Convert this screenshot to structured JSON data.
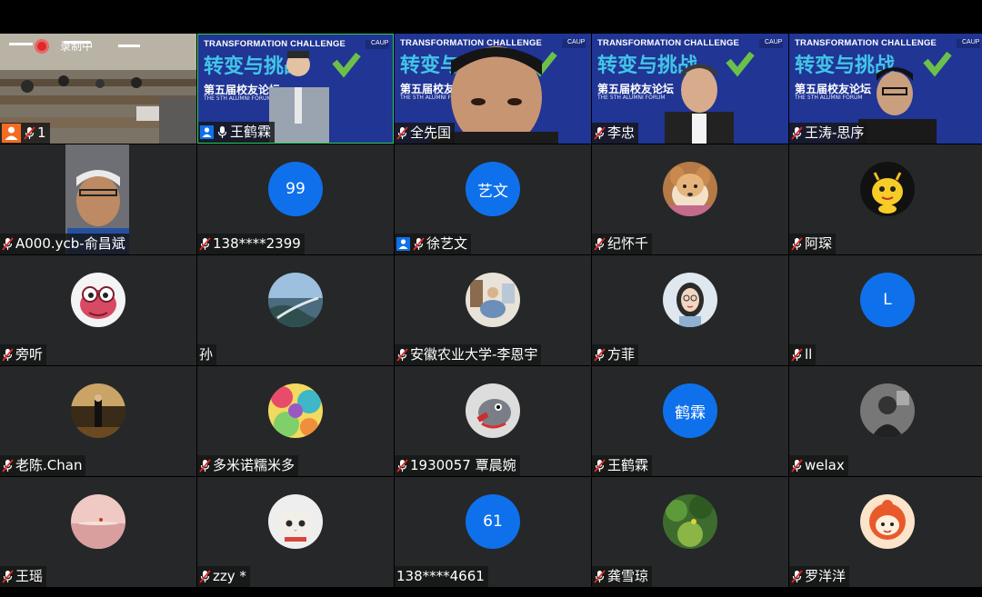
{
  "recording_label": "录制中",
  "banner": {
    "title_en": "TRANSFORMATION CHALLENGE",
    "logo_text": "CAUP",
    "title_cn": "转变与挑战",
    "subtitle_cn": "第五届校友论坛",
    "subtitle_en": "THE 5TH ALUMNI FORUM"
  },
  "participants": [
    {
      "name": "1",
      "type": "classroom",
      "host_icon": true
    },
    {
      "name": "王鹤霖",
      "type": "banner-speaker",
      "icon": "person"
    },
    {
      "name": "全先国",
      "type": "banner-face"
    },
    {
      "name": "李忠",
      "type": "banner-man1"
    },
    {
      "name": "王涛-思序",
      "type": "banner-man2"
    },
    {
      "name": "A000.ycb-俞昌斌",
      "type": "selfie"
    },
    {
      "name": "138****2399",
      "avatar_text": "99"
    },
    {
      "name": "徐艺文",
      "avatar_text": "艺文",
      "icon": "person"
    },
    {
      "name": "纪怀千",
      "avatar": "dog"
    },
    {
      "name": "阿琛",
      "avatar": "dragon"
    },
    {
      "name": "旁听",
      "avatar": "creature"
    },
    {
      "name": "孙",
      "avatar": "landscape",
      "no_mic": true
    },
    {
      "name": "安徽农业大学-李恩宇",
      "avatar": "room"
    },
    {
      "name": "方菲",
      "avatar": "girl"
    },
    {
      "name": "ll",
      "avatar_text": "L"
    },
    {
      "name": "老陈.Chan",
      "avatar": "stage"
    },
    {
      "name": "多米诺糯米多",
      "avatar": "colorful"
    },
    {
      "name": "1930057 覃晨婉",
      "avatar": "fish"
    },
    {
      "name": "王鹤霖",
      "avatar_text": "鹤霖"
    },
    {
      "name": "welax",
      "avatar": "bw"
    },
    {
      "name": "王瑶",
      "avatar": "pink"
    },
    {
      "name": "zzy *",
      "avatar": "cat"
    },
    {
      "name": "138****4661",
      "avatar_text": "61",
      "no_mic": true
    },
    {
      "name": "龚雪琼",
      "avatar": "forest"
    },
    {
      "name": "罗洋洋",
      "avatar": "cartoon"
    }
  ],
  "colors": {
    "avatar_blue": "#0e71eb",
    "tile_bg": "#262729",
    "banner_bg": "#203594",
    "accent_green": "#6cc04a"
  }
}
